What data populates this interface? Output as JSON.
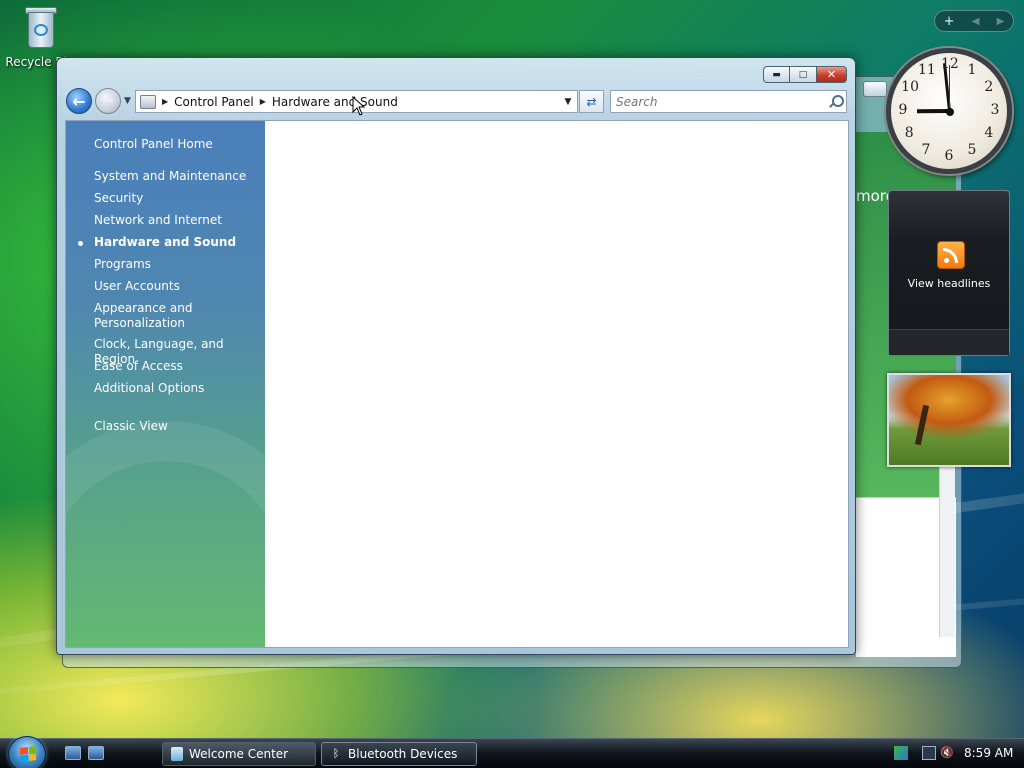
{
  "desktop": {
    "recycle_bin_label": "Recycle Bin"
  },
  "window": {
    "nav": {
      "breadcrumb": [
        "Control Panel",
        "Hardware and Sound"
      ],
      "search_placeholder": "Search"
    },
    "sidebar": {
      "home": "Control Panel Home",
      "items": [
        "System and Maintenance",
        "Security",
        "Network and Internet",
        "Hardware and Sound",
        "Programs",
        "User Accounts",
        "Appearance and Personalization",
        "Clock, Language, and Region",
        "Ease of Access",
        "Additional Options"
      ],
      "current_item": "Hardware and Sound",
      "classic_view": "Classic View"
    }
  },
  "background_window": {
    "partial_text": "more"
  },
  "gadgets": {
    "toolbar_add": "+",
    "clock": {
      "numbers": [
        "12",
        "1",
        "2",
        "3",
        "4",
        "5",
        "6",
        "7",
        "8",
        "9",
        "10",
        "11"
      ],
      "hour": 8,
      "minute": 59
    },
    "feed_label": "View headlines"
  },
  "taskbar": {
    "tasks": [
      "Welcome Center",
      "Bluetooth Devices"
    ],
    "active_task": "Bluetooth Devices",
    "clock": "8:59 AM"
  },
  "colors": {
    "sidebar_top": "#4b7fbb",
    "sidebar_bottom": "#64b972",
    "close_button": "#c8402c",
    "taskbar": "#0e141a"
  }
}
